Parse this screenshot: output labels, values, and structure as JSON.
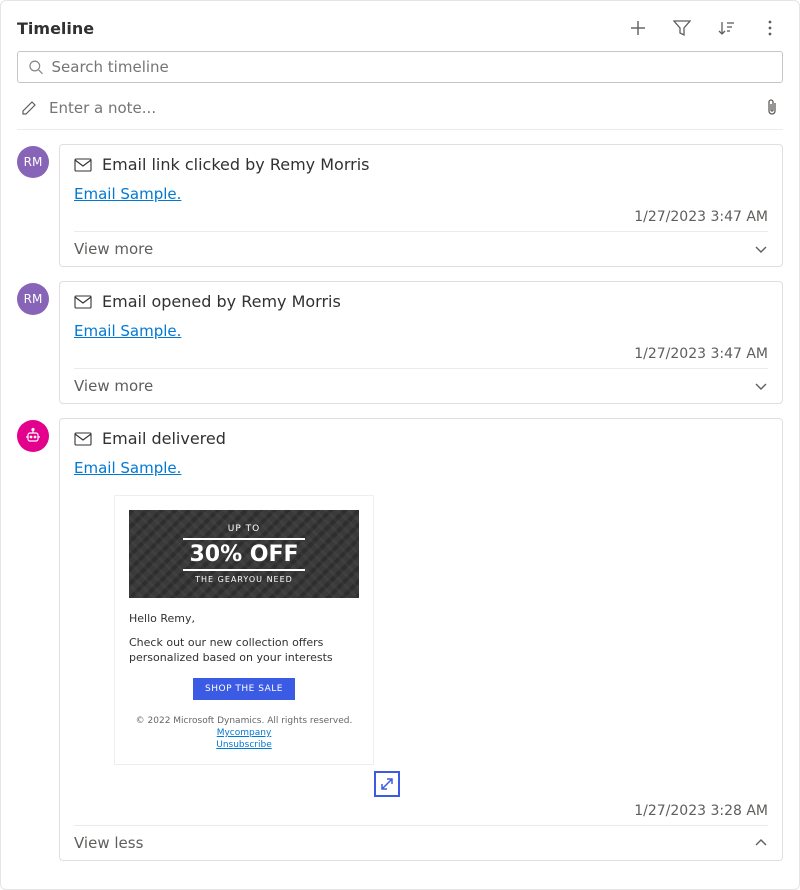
{
  "header": {
    "title": "Timeline"
  },
  "search": {
    "placeholder": "Search timeline"
  },
  "note": {
    "placeholder": "Enter a note..."
  },
  "entries": [
    {
      "avatar_initials": "RM",
      "avatar_class": "avatar-purple",
      "title": "Email link clicked by Remy Morris",
      "link_label": "Email Sample.",
      "timestamp": "1/27/2023 3:47 AM",
      "footer_label": "View more",
      "expanded": false
    },
    {
      "avatar_initials": "RM",
      "avatar_class": "avatar-purple",
      "title": "Email opened by Remy Morris",
      "link_label": "Email Sample.",
      "timestamp": "1/27/2023 3:47 AM",
      "footer_label": "View more",
      "expanded": false
    },
    {
      "avatar_initials": "",
      "avatar_class": "avatar-magenta",
      "title": "Email delivered",
      "link_label": "Email Sample.",
      "timestamp": "1/27/2023 3:28 AM",
      "footer_label": "View less",
      "expanded": true
    }
  ],
  "email_preview": {
    "banner_top": "UP TO",
    "banner_mid": "30% OFF",
    "banner_bot": "THE GEARYOU NEED",
    "hello": "Hello Remy,",
    "body": "Check out our new collection offers personalized based on your interests",
    "cta": "SHOP THE SALE",
    "copyright": "© 2022 Microsoft Dynamics. All rights reserved.",
    "company_link": "Mycompany",
    "unsubscribe": "Unsubscribe"
  }
}
